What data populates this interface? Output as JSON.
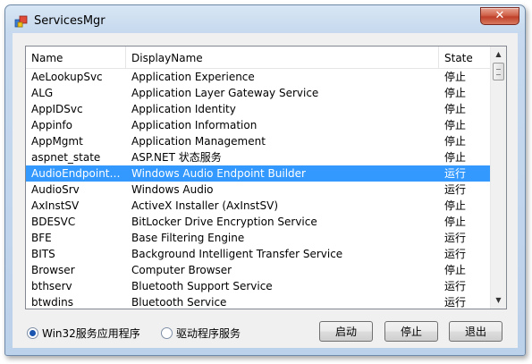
{
  "window": {
    "title": "ServicesMgr",
    "close_label": "✕"
  },
  "list": {
    "columns": [
      "Name",
      "DisplayName",
      "State"
    ],
    "rows": [
      {
        "name": "AeLookupSvc",
        "display": "Application Experience",
        "state": "停止"
      },
      {
        "name": "ALG",
        "display": "Application Layer Gateway Service",
        "state": "停止"
      },
      {
        "name": "AppIDSvc",
        "display": "Application Identity",
        "state": "停止"
      },
      {
        "name": "Appinfo",
        "display": "Application Information",
        "state": "停止"
      },
      {
        "name": "AppMgmt",
        "display": "Application Management",
        "state": "停止"
      },
      {
        "name": "aspnet_state",
        "display": "ASP.NET 状态服务",
        "state": "停止"
      },
      {
        "name": "AudioEndpointB...",
        "display": "Windows Audio Endpoint Builder",
        "state": "运行"
      },
      {
        "name": "AudioSrv",
        "display": "Windows Audio",
        "state": "运行"
      },
      {
        "name": "AxInstSV",
        "display": "ActiveX Installer (AxInstSV)",
        "state": "停止"
      },
      {
        "name": "BDESVC",
        "display": "BitLocker Drive Encryption Service",
        "state": "停止"
      },
      {
        "name": "BFE",
        "display": "Base Filtering Engine",
        "state": "运行"
      },
      {
        "name": "BITS",
        "display": "Background Intelligent Transfer Service",
        "state": "运行"
      },
      {
        "name": "Browser",
        "display": "Computer Browser",
        "state": "停止"
      },
      {
        "name": "bthserv",
        "display": "Bluetooth Support Service",
        "state": "运行"
      },
      {
        "name": "btwdins",
        "display": "Bluetooth Service",
        "state": "运行"
      }
    ],
    "selected_index": 6
  },
  "options": {
    "win32_label": "Win32服务应用程序",
    "driver_label": "驱动程序服务"
  },
  "buttons": {
    "start": "启动",
    "stop": "停止",
    "exit": "退出"
  },
  "colors": {
    "selection": "#3399ff",
    "close_button": "#c0402a"
  }
}
